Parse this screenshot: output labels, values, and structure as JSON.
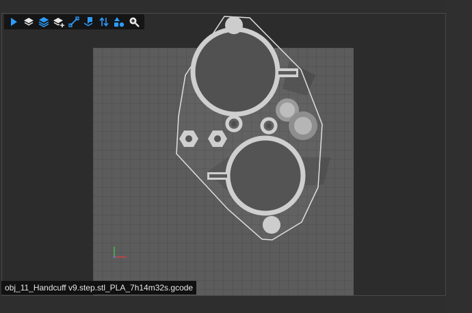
{
  "toolbar": {
    "buttons": [
      {
        "icon": "play-icon"
      },
      {
        "icon": "layer-down-icon"
      },
      {
        "icon": "layers-icon"
      },
      {
        "icon": "layer-add-icon"
      },
      {
        "icon": "line-segment-icon"
      },
      {
        "icon": "layer-export-icon"
      },
      {
        "icon": "sort-arrows-icon"
      },
      {
        "icon": "shapes-icon"
      },
      {
        "icon": "zoom-in-icon"
      }
    ],
    "accent": "#2d9cff"
  },
  "viewer": {
    "file_name": "obj_11_Handcuff v9.step.stl_PLA_7h14m32s.gcode",
    "bed_color": "#5c5c5c",
    "grid_color": "#4b4b4b",
    "part_color": "#c9c9c9"
  }
}
